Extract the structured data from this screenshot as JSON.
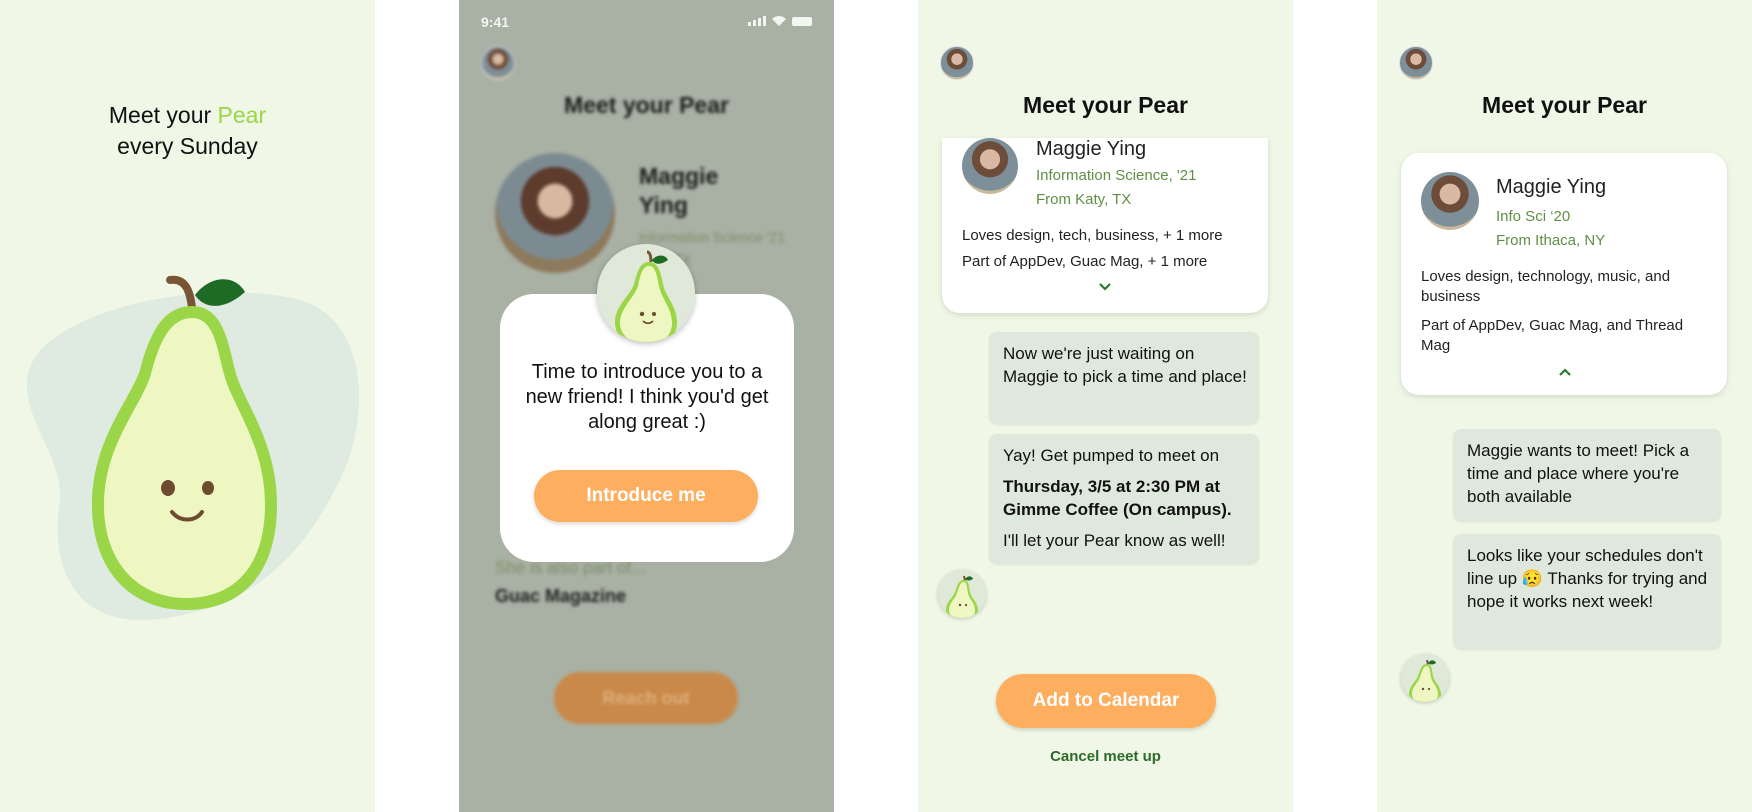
{
  "panel1": {
    "headline_prefix": "Meet your ",
    "headline_accent": "Pear",
    "headline_line2": "every Sunday"
  },
  "panel2": {
    "status": {
      "time": "9:41"
    },
    "title": "Meet your Pear",
    "profile": {
      "name": "Maggie Ying",
      "major": "Information Science '21",
      "from": "Katy, TX"
    },
    "also_part_label": "She is also part of...",
    "also_part_value": "Guac Magazine",
    "reach_out": "Reach out",
    "modal": {
      "message": "Time to introduce you to a new friend! I think you'd get along great :)",
      "button": "Introduce me"
    }
  },
  "panel3": {
    "title": "Meet your Pear",
    "card": {
      "name": "Maggie Ying",
      "major": "Information Science, '21",
      "from": "From Katy, TX",
      "loves": "Loves design, tech, business, + 1 more",
      "part_of": "Part of AppDev, Guac Mag, + 1 more"
    },
    "bubble1": "Now we're just waiting on Maggie to pick a time and place!",
    "bubble2_line1": "Yay! Get pumped to meet on",
    "bubble2_bold": "Thursday, 3/5 at 2:30 PM at Gimme Coffee (On campus).",
    "bubble2_line3": "I'll let your Pear know as well!",
    "calendar_button": "Add to Calendar",
    "cancel_link": "Cancel meet up"
  },
  "panel4": {
    "title": "Meet your Pear",
    "card": {
      "name": "Maggie Ying",
      "major": "Info Sci ‘20",
      "from": "From Ithaca, NY",
      "loves": "Loves design, technology, music, and business",
      "part_of": "Part of AppDev, Guac Mag, and Thread Mag"
    },
    "bubble1": "Maggie wants to meet! Pick a time and place where you're both available",
    "bubble2": "Looks like your schedules don't line up 😥 Thanks for trying and hope it works next week!"
  },
  "colors": {
    "accent": "#9bd548",
    "orange": "#fdae5f",
    "panel_bg": "#f0f7e6",
    "bubble": "#dfe8dc",
    "link_green": "#2b6b2b"
  },
  "icons": [
    "pear-mascot-icon",
    "signal-icon",
    "wifi-icon",
    "battery-icon",
    "chevron-down-icon",
    "chevron-up-icon"
  ]
}
